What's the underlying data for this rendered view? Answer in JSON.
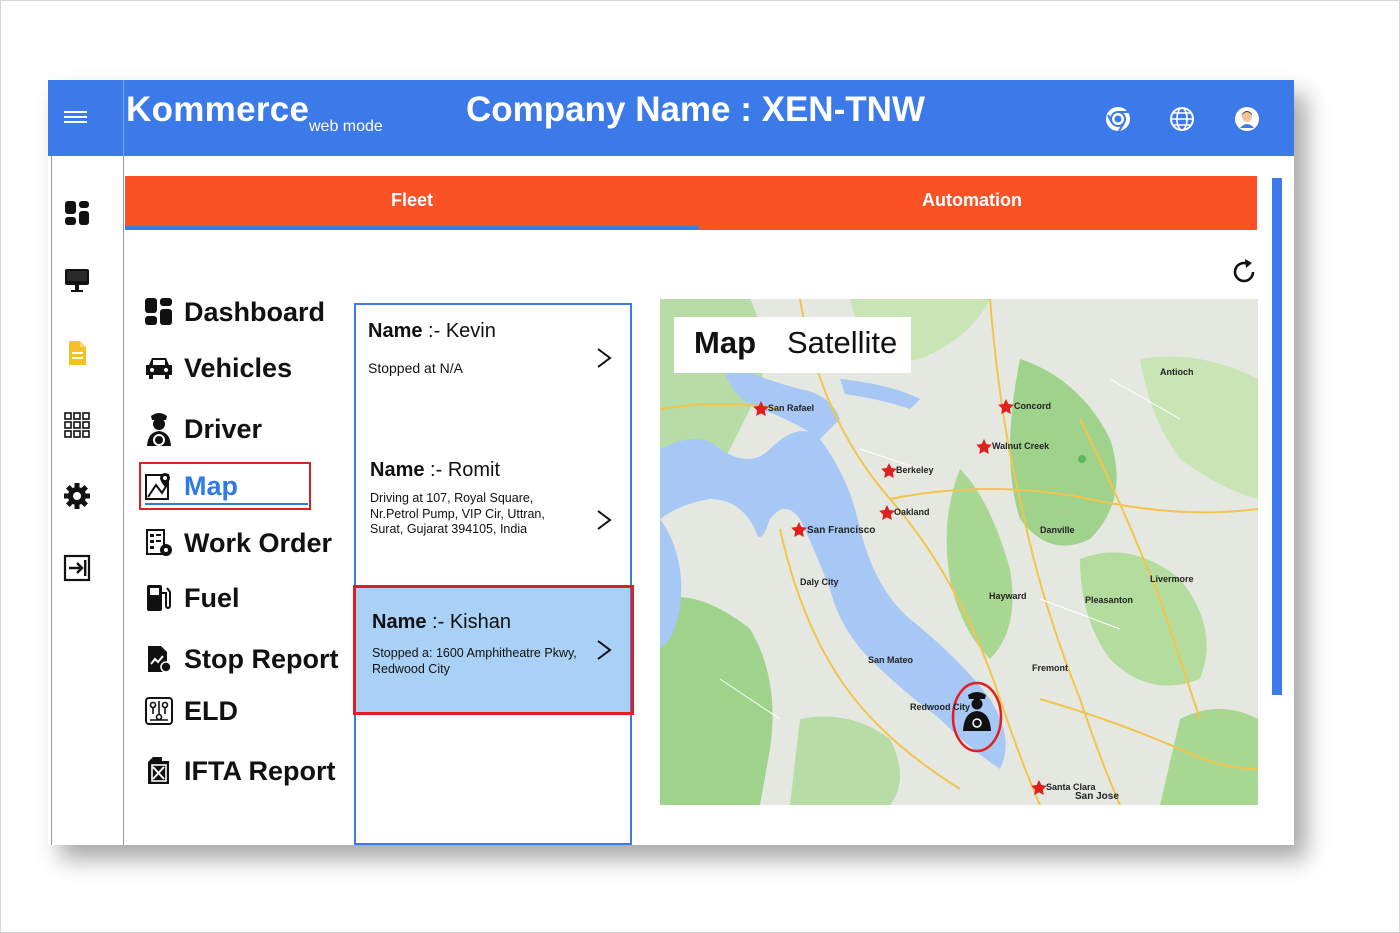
{
  "header": {
    "brand": "Kommerce",
    "brand_sub": "web mode",
    "company": "Company Name : XEN-TNW",
    "color": "#3b7ae8"
  },
  "rail_icons": [
    "dashboard-icon",
    "monitor-icon",
    "document-icon",
    "grid-icon",
    "gear-icon",
    "logout-icon"
  ],
  "tabs": [
    {
      "label": "Fleet",
      "active": true
    },
    {
      "label": "Automation",
      "active": false
    }
  ],
  "tab_color": "#fa5224",
  "nav": [
    {
      "label": "Dashboard",
      "icon": "dashboard-icon"
    },
    {
      "label": "Vehicles",
      "icon": "car-icon"
    },
    {
      "label": "Driver",
      "icon": "driver-icon"
    },
    {
      "label": "Map",
      "icon": "map-icon",
      "active": true
    },
    {
      "label": "Work Order",
      "icon": "work-order-icon"
    },
    {
      "label": "Fuel",
      "icon": "fuel-icon"
    },
    {
      "label": "Stop Report",
      "icon": "stop-report-icon"
    },
    {
      "label": "ELD",
      "icon": "eld-icon"
    },
    {
      "label": "IFTA Report",
      "icon": "ifta-report-icon"
    }
  ],
  "drivers": [
    {
      "name_label": "Name",
      "name_sep": " :- ",
      "name": "Kevin",
      "status": "Stopped at N/A"
    },
    {
      "name_label": "Name",
      "name_sep": " :- ",
      "name": "Romit",
      "status": "Driving at 107, Royal Square, Nr.Petrol Pump, VIP Cir, Uttran, Surat, Gujarat 394105, India"
    },
    {
      "name_label": "Name",
      "name_sep": " :- ",
      "name": "Kishan",
      "status": "Stopped a: 1600 Amphitheatre Pkwy, Redwood City",
      "selected": true
    }
  ],
  "map": {
    "toggle": [
      "Map",
      "Satellite"
    ],
    "places": [
      "San Rafael",
      "San Francisco",
      "Berkeley",
      "Oakland",
      "Concord",
      "Walnut Creek",
      "Fremont",
      "San Jose",
      "Santa Clara",
      "Redwood City",
      "Daly City",
      "San Mateo",
      "Hayward",
      "Pleasanton",
      "Livermore",
      "Danville",
      "Antioch"
    ]
  }
}
